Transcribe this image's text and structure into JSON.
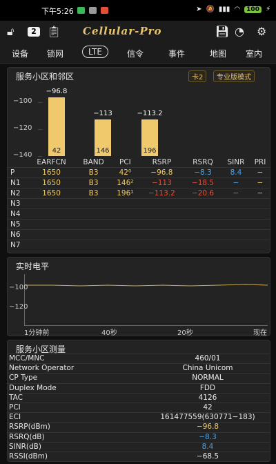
{
  "status_bar": {
    "time": "下午5:26",
    "battery": "100"
  },
  "toolbar": {
    "badge": "2",
    "title": "Cellular-Pro"
  },
  "tabs": [
    "设备",
    "锁网",
    "LTE",
    "信令",
    "事件",
    "地图",
    "室内"
  ],
  "serving": {
    "title": "服务小区和邻区",
    "card_button": "卡2",
    "pro_button": "专业版模式",
    "chart_data": {
      "type": "bar",
      "categories": [
        "42",
        "146",
        "196"
      ],
      "values": [
        -96.8,
        -113,
        -113.2
      ],
      "value_labels": [
        "−96.8",
        "−113",
        "−113.2"
      ],
      "yticks": [
        "−100",
        "−120",
        "−140"
      ],
      "ylim": [
        -140,
        -90
      ],
      "colors": {
        "bar": "#f0c96c"
      }
    },
    "table": {
      "headers": [
        "",
        "EARFCN",
        "BAND",
        "PCI",
        "RSRP",
        "RSRQ",
        "SINR",
        "PRI"
      ],
      "rows": [
        {
          "name": "P",
          "cells": [
            "1650",
            "B3",
            "42⁰",
            "−96.8",
            "−8.3",
            "8.4",
            "−"
          ]
        },
        {
          "name": "N1",
          "cells": [
            "1650",
            "B3",
            "146²",
            "−113",
            "−18.5",
            "−",
            "−"
          ]
        },
        {
          "name": "N2",
          "cells": [
            "1650",
            "B3",
            "196¹",
            "−113.2",
            "−20.6",
            "−",
            "−"
          ]
        },
        {
          "name": "N3",
          "cells": [
            "",
            "",
            "",
            "",
            "",
            "",
            ""
          ]
        },
        {
          "name": "N4",
          "cells": [
            "",
            "",
            "",
            "",
            "",
            "",
            ""
          ]
        },
        {
          "name": "N5",
          "cells": [
            "",
            "",
            "",
            "",
            "",
            "",
            ""
          ]
        },
        {
          "name": "N6",
          "cells": [
            "",
            "",
            "",
            "",
            "",
            "",
            ""
          ]
        },
        {
          "name": "N7",
          "cells": [
            "",
            "",
            "",
            "",
            "",
            "",
            ""
          ]
        }
      ]
    }
  },
  "realtime": {
    "title": "实时电平",
    "yticks": [
      "−100",
      "−120"
    ],
    "xticks": [
      "1分钟前",
      "40秒",
      "20秒",
      "现在"
    ]
  },
  "measurement": {
    "title": "服务小区测量",
    "rows": [
      {
        "k": "MCC/MNC",
        "v": "460/01",
        "color": "white"
      },
      {
        "k": "Network Operator",
        "v": "China Unicom",
        "color": "white"
      },
      {
        "k": "CP Type",
        "v": "NORMAL",
        "color": "white"
      },
      {
        "k": "Duplex Mode",
        "v": "FDD",
        "color": "white"
      },
      {
        "k": "TAC",
        "v": "4126",
        "color": "white"
      },
      {
        "k": "PCI",
        "v": "42",
        "color": "white"
      },
      {
        "k": "ECI",
        "v": "161477559(630771−183)",
        "color": "white"
      },
      {
        "k": "RSRP(dBm)",
        "v": "−96.8",
        "color": "orange"
      },
      {
        "k": "RSRQ(dB)",
        "v": "−8.3",
        "color": "blue"
      },
      {
        "k": "SINR(dB)",
        "v": "8.4",
        "color": "blue"
      },
      {
        "k": "RSSI(dBm)",
        "v": "−68.5",
        "color": "white"
      }
    ]
  }
}
